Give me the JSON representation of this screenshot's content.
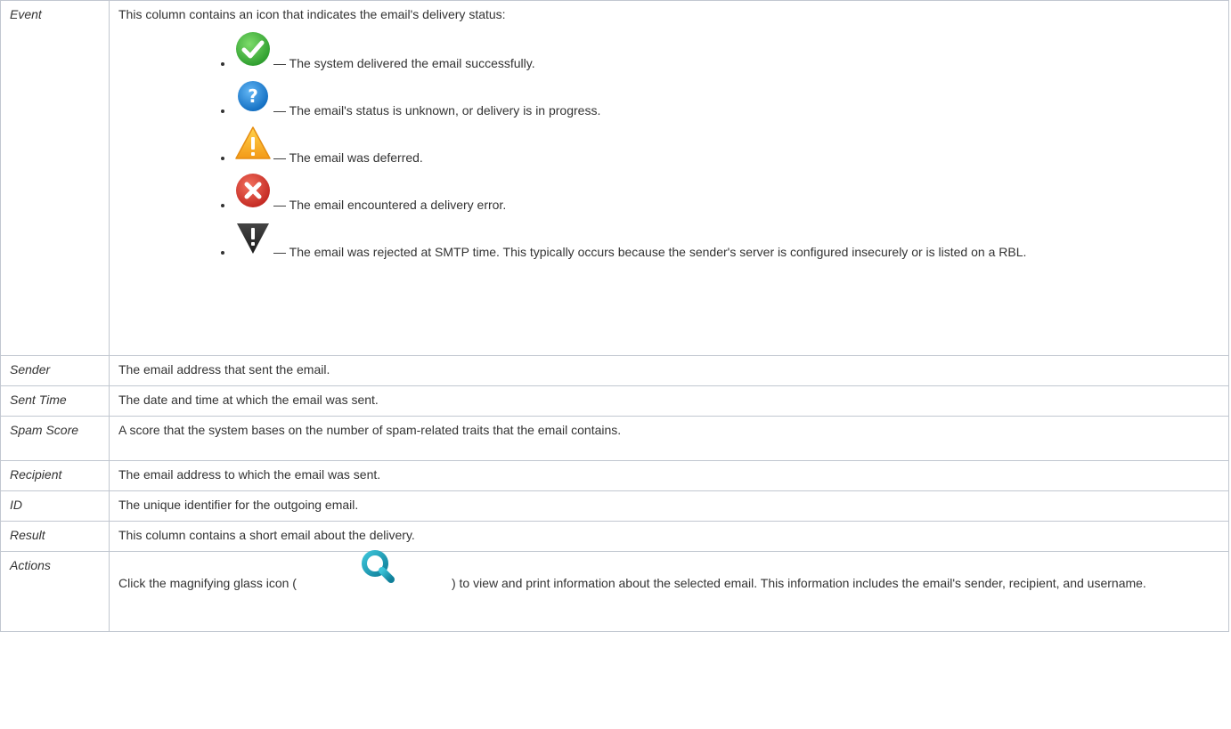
{
  "table": {
    "rows": [
      {
        "name": "Event",
        "intro": "This column contains an icon that indicates the email's delivery status:",
        "items": [
          {
            "icon": "success-check-icon",
            "text": "— The system delivered the email successfully."
          },
          {
            "icon": "unknown-question-icon",
            "text": "— The email's status is unknown, or delivery is in progress."
          },
          {
            "icon": "deferred-warning-icon",
            "text": "— The email was deferred."
          },
          {
            "icon": "error-x-icon",
            "text": "— The email encountered a delivery error."
          },
          {
            "icon": "rejected-alert-icon",
            "text": "— The email was rejected at SMTP time. This typically occurs because the sender's server is configured insecurely or is listed on a RBL."
          }
        ]
      },
      {
        "name": "Sender",
        "desc": "The email address that sent the email."
      },
      {
        "name": "Sent Time",
        "desc": "The date and time at which the email was sent."
      },
      {
        "name": "Spam Score",
        "desc": "A score that the system bases on the number of spam-related traits that the email contains."
      },
      {
        "name": "Recipient",
        "desc": "The email address to which the email was sent."
      },
      {
        "name": "ID",
        "desc": "The unique identifier for the outgoing email."
      },
      {
        "name": "Result",
        "desc": "This column contains a short email about the delivery."
      },
      {
        "name": "Actions",
        "desc_before": "Click the magnifying glass icon (",
        "desc_icon": "magnifying-glass-icon",
        "desc_after": ") to view and print information about the selected email. This information includes the email's sender, recipient, and username."
      }
    ]
  },
  "colors": {
    "border": "#c1c7d0",
    "text": "#333333",
    "success": "#3cb33c",
    "unknown": "#1e88d8",
    "deferred": "#f6a623",
    "error": "#d9332b",
    "rejected": "#333333",
    "magnifier": "#1a9fb8"
  }
}
